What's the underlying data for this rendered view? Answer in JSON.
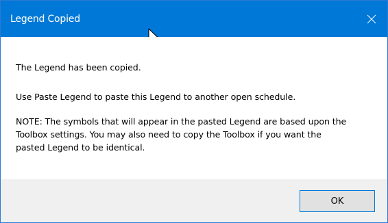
{
  "window": {
    "title": "Legend Copied",
    "close_icon": "close-icon"
  },
  "message": {
    "line1": "The Legend has been copied.",
    "line2": "Use Paste Legend to paste this Legend to another open schedule.",
    "note_lines": [
      "NOTE: The symbols that will appear in the pasted Legend are based upon the",
      "Toolbox settings. You may also need to copy the Toolbox if you want the",
      "pasted Legend to be identical."
    ]
  },
  "buttons": {
    "ok_label": "OK"
  },
  "colors": {
    "titlebar": "#0078d7",
    "footer": "#f0f0f0",
    "button_border": "#0078d7"
  }
}
